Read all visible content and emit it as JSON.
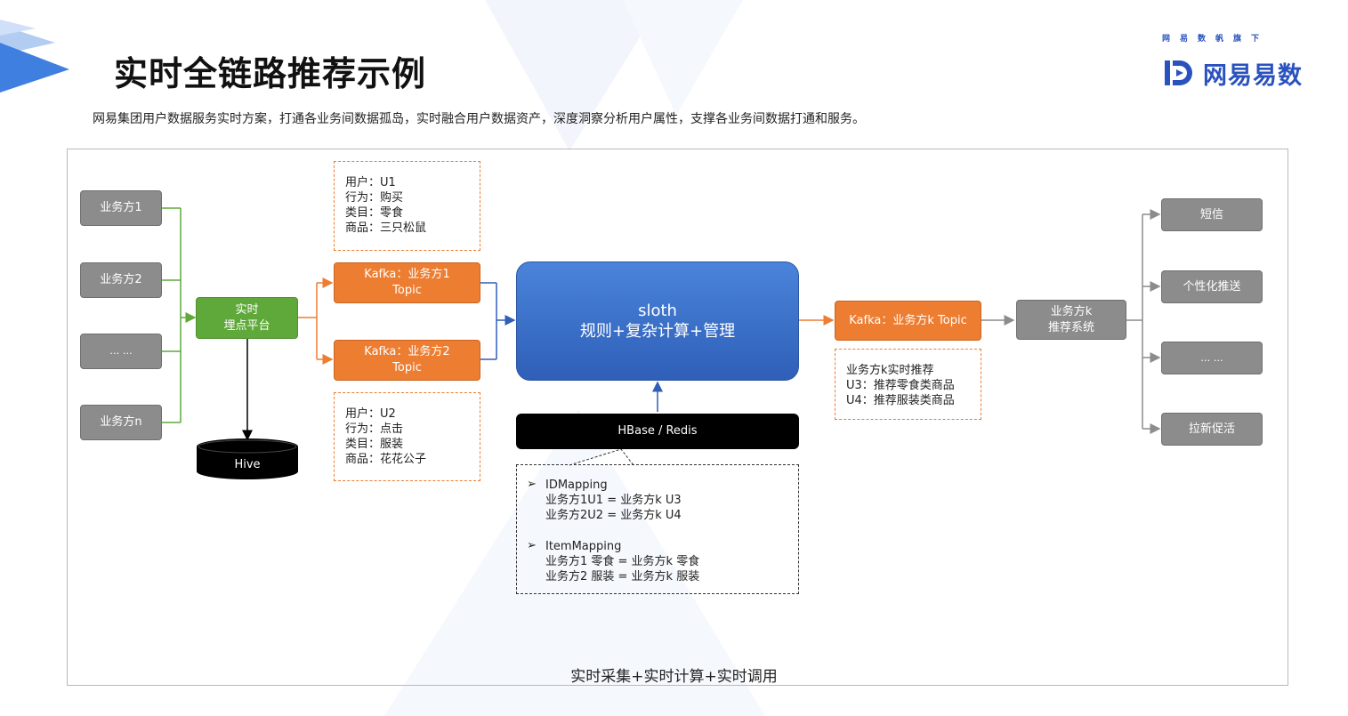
{
  "header": {
    "title": "实时全链路推荐示例",
    "subtitle": "网易集团用户数据服务实时方案，打通各业务间数据孤岛，实时融合用户数据资产，深度洞察分析用户属性，支撑各业务间数据打通和服务。",
    "brand_top": "网易数帆旗下",
    "brand_name": "网易易数"
  },
  "sources": [
    "业务方1",
    "业务方2",
    "… …",
    "业务方n"
  ],
  "collector": "实时\n埋点平台",
  "hive": "Hive",
  "kafka": {
    "k1": "Kafka：业务方1\nTopic",
    "k2": "Kafka：业务方2\nTopic",
    "kk": "Kafka：业务方k Topic"
  },
  "notes": {
    "u1": "用户：U1\n行为：购买\n类目：零食\n商品：三只松鼠",
    "u2": "用户：U2\n行为：点击\n类目：服装\n商品：花花公子",
    "rec": "业务方k实时推荐\nU3：推荐零食类商品\nU4：推荐服装类商品"
  },
  "engine": "sloth\n规则+复杂计算+管理",
  "storage": "HBase / Redis",
  "mapping": {
    "id_title": "IDMapping",
    "id_lines": "业务方1U1 = 业务方k U3\n业务方2U2 = 业务方k U4",
    "item_title": "ItemMapping",
    "item_lines": "业务方1 零食 = 业务方k 零食\n业务方2 服装 = 业务方k 服装"
  },
  "recsys": "业务方k\n推荐系统",
  "outputs": [
    "短信",
    "个性化推送",
    "… …",
    "拉新促活"
  ],
  "caption": "实时采集+实时计算+实时调用",
  "colors": {
    "green": "#5fa83a",
    "orange": "#ed7d31",
    "blue": "#2f5fb8",
    "gray": "#8c8c8c",
    "brand": "#2a52be"
  }
}
